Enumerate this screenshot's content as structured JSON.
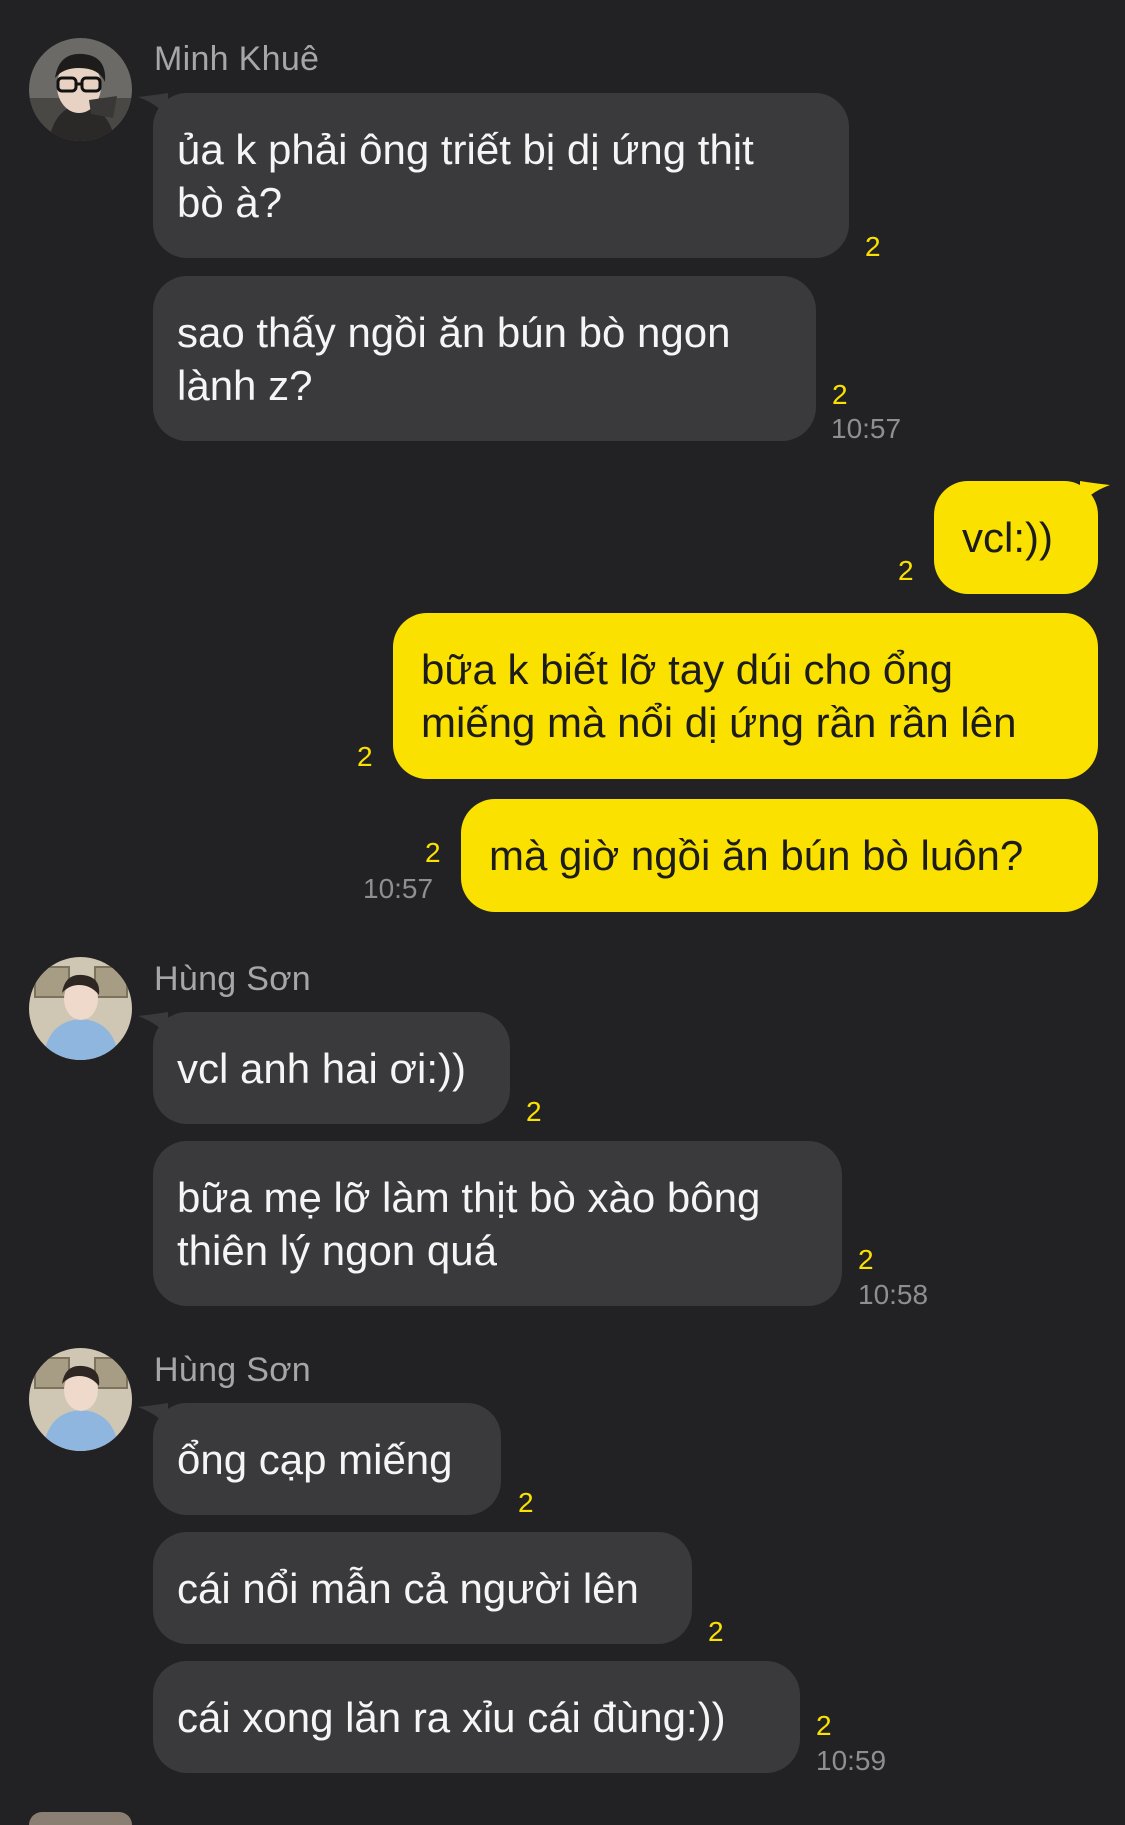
{
  "colors": {
    "background": "#222224",
    "incoming_bubble": "#3a3a3c",
    "outgoing_bubble": "#fae100",
    "unread_count": "#fae100",
    "sender_name": "#a6a6aa",
    "timestamp": "#8e8e93"
  },
  "groups": [
    {
      "sender": "Minh Khuê",
      "avatar_icon": "person-with-glasses-avatar-icon",
      "messages": [
        {
          "text": "ủa k phải ông triết bị dị ứng thịt\nbò à?",
          "unread": "2"
        },
        {
          "text": "sao thấy ngồi ăn bún bò ngon\nlành z?",
          "unread": "2",
          "time": "10:57"
        }
      ]
    },
    {
      "sender": "me",
      "messages": [
        {
          "text": "vcl:))",
          "unread": "2"
        },
        {
          "text": "bữa k biết lỡ tay dúi cho ổng\nmiếng mà nổi dị ứng rần rần lên",
          "unread": "2"
        },
        {
          "text": "mà giờ ngồi ăn bún bò luôn?",
          "unread": "2",
          "time": "10:57"
        }
      ]
    },
    {
      "sender": "Hùng Sơn",
      "avatar_icon": "person-in-blue-hoodie-avatar-icon",
      "messages": [
        {
          "text": "vcl anh hai ơi:))",
          "unread": "2"
        },
        {
          "text": "bữa mẹ lỡ làm thịt bò xào bông\nthiên lý ngon quá",
          "unread": "2",
          "time": "10:58"
        }
      ]
    },
    {
      "sender": "Hùng Sơn",
      "avatar_icon": "person-in-blue-hoodie-avatar-icon",
      "messages": [
        {
          "text": "ổng cạp miếng",
          "unread": "2"
        },
        {
          "text": "cái nổi mẫn cả người lên",
          "unread": "2"
        },
        {
          "text": "cái xong lăn ra xỉu cái đùng:))",
          "unread": "2",
          "time": "10:59"
        }
      ]
    }
  ]
}
